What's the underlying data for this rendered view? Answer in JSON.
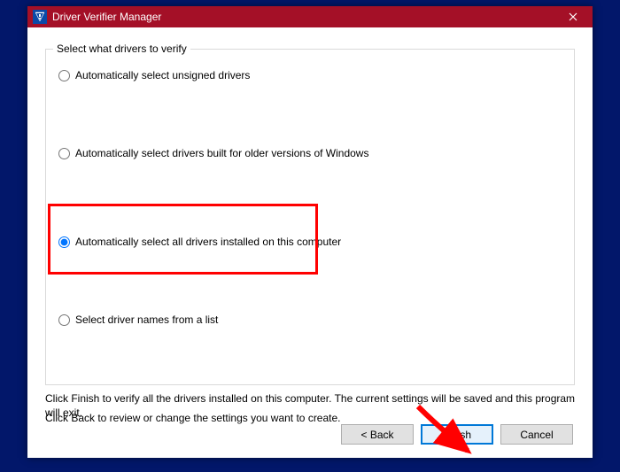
{
  "window": {
    "title": "Driver Verifier Manager"
  },
  "groupbox": {
    "legend": "Select what drivers to verify",
    "options": [
      "Automatically select unsigned drivers",
      "Automatically select drivers built for older versions of Windows",
      "Automatically select all drivers installed on this computer",
      "Select driver names from a list"
    ],
    "selected_index": 2,
    "highlighted_index": 2
  },
  "info": {
    "line1": "Click Finish to verify all the drivers installed on this computer. The current settings will be saved and this program will exit.",
    "line2": "Click Back to review or change the settings you want to create."
  },
  "buttons": {
    "back": "< Back",
    "finish": "Finish",
    "cancel": "Cancel"
  },
  "annotation": {
    "arrow_color": "#ff0000"
  }
}
